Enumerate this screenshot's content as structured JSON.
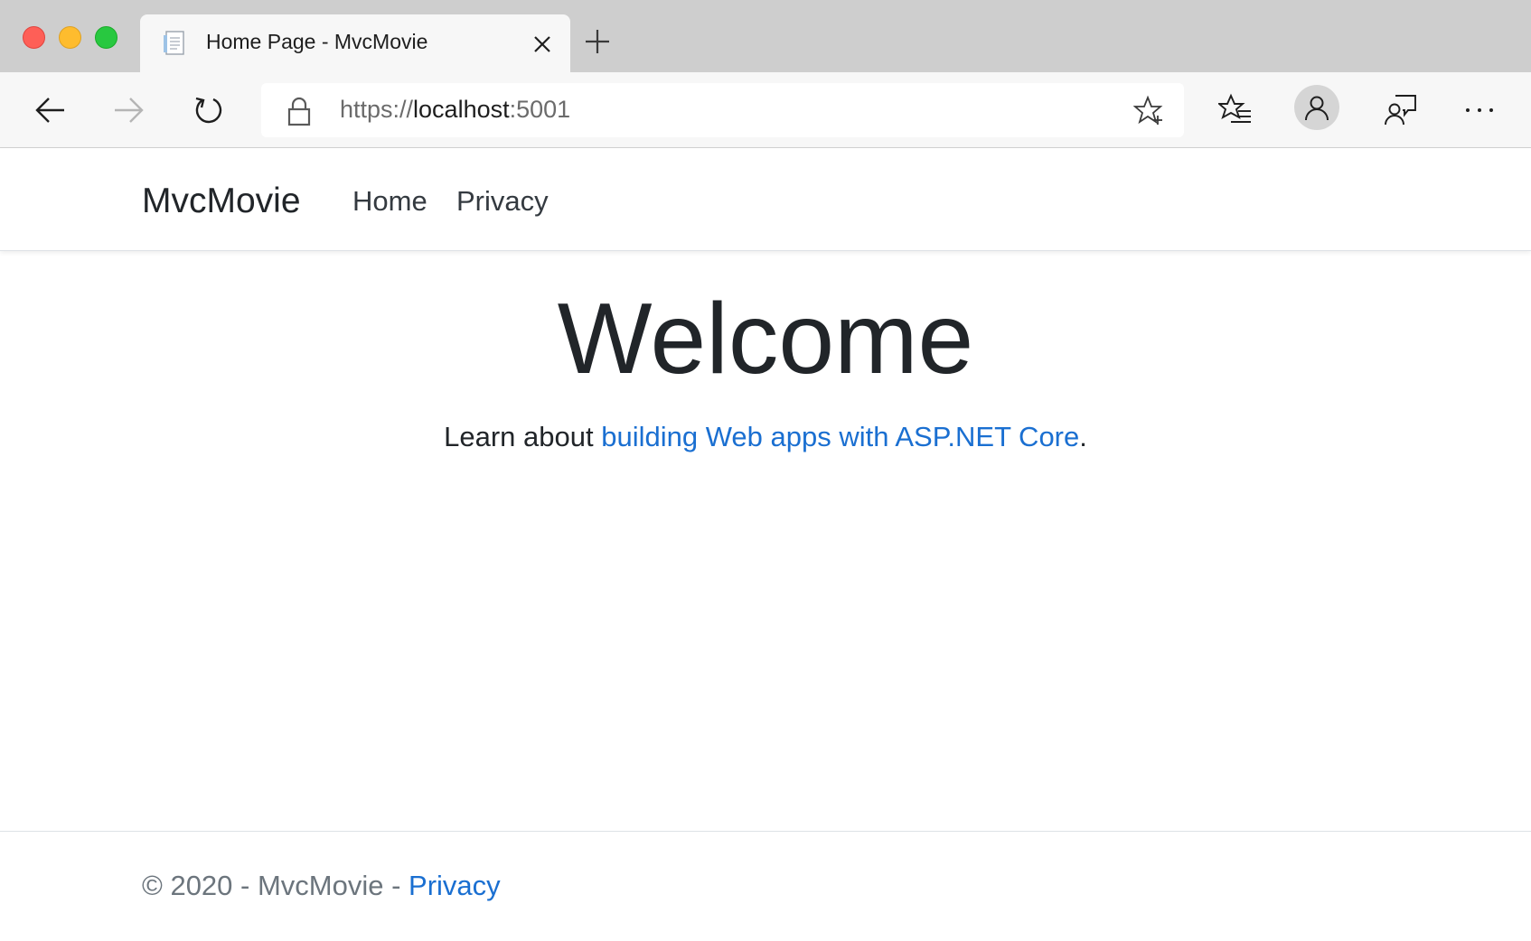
{
  "browser": {
    "tab": {
      "title": "Home Page - MvcMovie",
      "favicon": "page-document-icon"
    },
    "address_bar": {
      "scheme": "https://",
      "host": "localhost",
      "port": ":5001"
    },
    "icons": {
      "back": "arrow-left-icon",
      "forward": "arrow-right-icon",
      "refresh": "refresh-icon",
      "lock": "lock-icon",
      "add_favorite": "star-plus-icon",
      "favorites": "favorites-list-icon",
      "profile": "person-icon",
      "feedback": "feedback-icon",
      "more": "ellipsis-icon",
      "new_tab": "plus-icon",
      "close_tab": "close-icon"
    },
    "colors": {
      "traffic_red": "#fe5f57",
      "traffic_yellow": "#febc2e",
      "traffic_green": "#28c840"
    }
  },
  "site": {
    "navbar": {
      "brand": "MvcMovie",
      "links": [
        {
          "label": "Home"
        },
        {
          "label": "Privacy"
        }
      ]
    },
    "main": {
      "heading": "Welcome",
      "intro_prefix": "Learn about ",
      "intro_link": "building Web apps with ASP.NET Core",
      "intro_suffix": "."
    },
    "footer": {
      "text": "© 2020 - MvcMovie - ",
      "link": "Privacy"
    },
    "colors": {
      "link": "#1a6fd1",
      "text": "#212529",
      "muted": "#6c757d"
    }
  }
}
